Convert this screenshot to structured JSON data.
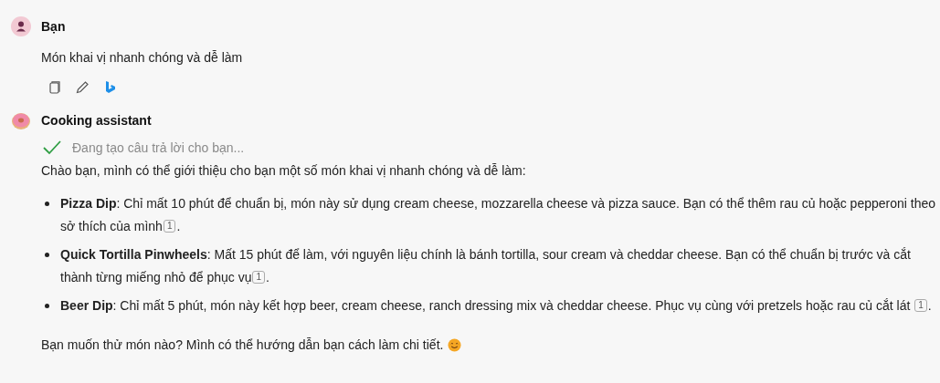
{
  "user_message": {
    "author": "Bạn",
    "text": "Món khai vị nhanh chóng và dễ làm"
  },
  "assistant_message": {
    "author": "Cooking assistant",
    "status": {
      "text": "Đang tạo câu trả lời cho bạn...",
      "done": true
    },
    "intro": "Chào bạn, mình có thể giới thiệu cho bạn một số món khai vị nhanh chóng và dễ làm:",
    "items": [
      {
        "text": "**Pizza Dip**: Chỉ mất 10 phút để chuẩn bị, món này sử dụng cream cheese, mozzarella cheese và pizza sauce. Bạn có thể thêm rau củ hoặc pepperoni theo sở thích của mình",
        "citation": "1",
        "end": "."
      },
      {
        "text": "**Quick Tortilla Pinwheels**: Mất 15 phút để làm, với nguyên liệu chính là bánh tortilla, sour cream và cheddar cheese. Bạn có thể chuẩn bị trước và cắt thành từng miếng nhỏ để phục vụ",
        "citation": "1",
        "end": "."
      },
      {
        "text": "**Beer Dip**: Chỉ mất 5 phút, món này kết hợp beer, cream cheese, ranch dressing mix và cheddar cheese. Phục vụ cùng với pretzels hoặc rau củ cắt lát ",
        "citation": "1",
        "end": "."
      }
    ],
    "closing": "Bạn muốn thử món nào? Mình có thể hướng dẫn bạn cách làm chi tiết."
  }
}
